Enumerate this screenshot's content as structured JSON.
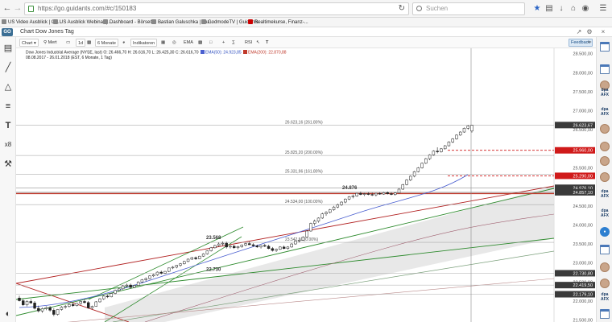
{
  "browser": {
    "url": "https://go.guidants.com/#c/150183",
    "search_placeholder": "Suchen",
    "bookmarks": [
      "US Video Ausblick | Gu...",
      "US Ausblick Webinar | ...",
      "Dashboard - BörseGo ...",
      "Bastian Galuschka | Gu...",
      "GodmodeTV | Guidants",
      "Realtimekurse, Finanz-..."
    ]
  },
  "app": {
    "logo": "GO",
    "chart_title": "Chart Dow Jones Tag"
  },
  "toolbar": {
    "chart_btn": "Chart",
    "mark_btn": "Mert",
    "interval": "1d",
    "period": "6 Monate",
    "indicators_btn": "Indikatoren",
    "ema_btn": "EMA",
    "rsi_btn": "RSI",
    "feedback": "Feedback"
  },
  "legend": {
    "line1": "Dow Jones Industrial Average (NYSE, last)  O: 26.466,70   H: 26.616,70   L: 26.425,30   C: 26.616,70",
    "ema50": "EMA(50): 24.923,85",
    "ema200": "EMA(200): 22.870,88",
    "line2": "08.08.2017 - 26.01.2018  (EST, 6 Monate, 1 Tag)"
  },
  "colors": {
    "ema50": "#4a5fd0",
    "ema200": "#c0392b",
    "channel_green": "#2e8b2e",
    "channel_red": "#b22222",
    "candle_up": "#ffffff",
    "candle_down": "#222222",
    "price_label_bg": "#3a3a3a",
    "price_label_red": "#d01a1a"
  },
  "chart_data": {
    "type": "candlestick",
    "instrument": "Dow Jones Industrial Average",
    "y_axis_ticks": [
      21500,
      22000,
      22500,
      23000,
      23500,
      24000,
      24500,
      25000,
      25500,
      26000,
      26500,
      27000,
      27500,
      28000,
      28500
    ],
    "y_tick_labels": [
      "21.500,00",
      "22.000,00",
      "22.500,00",
      "23.000,00",
      "23.500,00",
      "24.000,00",
      "24.500,00",
      "25.000,00",
      "25.500,00",
      "26.000,00",
      "26.500,00",
      "27.000,00",
      "27.500,00",
      "28.000,00",
      "28.500,00"
    ],
    "ylim": [
      21450,
      28640
    ],
    "price_labels": [
      {
        "value": 26623.67,
        "text": "26.623,67",
        "style": "dark"
      },
      {
        "value": 25960,
        "text": "25.960,00",
        "style": "red"
      },
      {
        "value": 25290,
        "text": "25.290,00",
        "style": "red"
      },
      {
        "value": 24976.1,
        "text": "24.976,10",
        "style": "dark"
      },
      {
        "value": 24857,
        "text": "24.857,10",
        "style": "dark"
      },
      {
        "value": 22730.8,
        "text": "22.730,80",
        "style": "dark"
      },
      {
        "value": 22419.5,
        "text": "22.419,50",
        "style": "dark"
      },
      {
        "value": 22179.1,
        "text": "22.179,10",
        "style": "dark"
      }
    ],
    "fib_levels": [
      {
        "value": 26623.16,
        "label": "26.623,16 (261.80%)"
      },
      {
        "value": 25825.2,
        "label": "25.825,20 (200.00%)"
      },
      {
        "value": 25331.96,
        "label": "25.331,96 (161.80%)"
      },
      {
        "value": 24534.0,
        "label": "24.534,00 (100.00%)"
      },
      {
        "value": 23542.5,
        "label": "23.542,50 (0.00%)"
      }
    ],
    "annotations": [
      {
        "text": "23.568",
        "value": 23568
      },
      {
        "text": "22.730",
        "value": 22730
      },
      {
        "text": "24.876",
        "value": 24876
      }
    ],
    "ohlc": [
      [
        22080,
        22140,
        21990,
        22010
      ],
      [
        22010,
        22060,
        21870,
        21900
      ],
      [
        21900,
        22020,
        21860,
        21990
      ],
      [
        21990,
        22050,
        21930,
        21950
      ],
      [
        21950,
        22000,
        21780,
        21810
      ],
      [
        21810,
        21880,
        21700,
        21740
      ],
      [
        21740,
        21830,
        21690,
        21800
      ],
      [
        21800,
        21860,
        21760,
        21830
      ],
      [
        21830,
        21870,
        21720,
        21760
      ],
      [
        21760,
        21810,
        21600,
        21650
      ],
      [
        21650,
        21790,
        21620,
        21780
      ],
      [
        21780,
        21870,
        21750,
        21840
      ],
      [
        21840,
        21900,
        21800,
        21860
      ],
      [
        21860,
        21940,
        21830,
        21910
      ],
      [
        21910,
        21960,
        21850,
        21880
      ],
      [
        21880,
        21950,
        21860,
        21940
      ],
      [
        21940,
        22010,
        21900,
        21990
      ],
      [
        21990,
        22050,
        21940,
        21960
      ],
      [
        21960,
        22000,
        21800,
        21820
      ],
      [
        21820,
        21880,
        21780,
        21860
      ],
      [
        21860,
        22000,
        21850,
        21980
      ],
      [
        21980,
        22080,
        21960,
        22060
      ],
      [
        22060,
        22150,
        22030,
        22130
      ],
      [
        22130,
        22170,
        22080,
        22110
      ],
      [
        22110,
        22210,
        22100,
        22200
      ],
      [
        22200,
        22300,
        22180,
        22280
      ],
      [
        22280,
        22340,
        22240,
        22320
      ],
      [
        22320,
        22420,
        22300,
        22400
      ],
      [
        22400,
        22460,
        22360,
        22420
      ],
      [
        22420,
        22460,
        22330,
        22360
      ],
      [
        22360,
        22430,
        22340,
        22410
      ],
      [
        22410,
        22520,
        22400,
        22500
      ],
      [
        22500,
        22580,
        22480,
        22560
      ],
      [
        22560,
        22620,
        22520,
        22590
      ],
      [
        22590,
        22680,
        22570,
        22660
      ],
      [
        22660,
        22720,
        22630,
        22690
      ],
      [
        22690,
        22780,
        22660,
        22760
      ],
      [
        22760,
        22800,
        22700,
        22730
      ],
      [
        22730,
        22790,
        22710,
        22780
      ],
      [
        22780,
        22880,
        22760,
        22870
      ],
      [
        22870,
        22920,
        22840,
        22890
      ],
      [
        22890,
        22950,
        22860,
        22940
      ],
      [
        22940,
        23000,
        22900,
        22980
      ],
      [
        22980,
        23060,
        22960,
        23040
      ],
      [
        23040,
        23120,
        23020,
        23100
      ],
      [
        23100,
        23160,
        23080,
        23140
      ],
      [
        23140,
        23170,
        23080,
        23110
      ],
      [
        23110,
        23190,
        23100,
        23180
      ],
      [
        23180,
        23260,
        23160,
        23240
      ],
      [
        23240,
        23330,
        23220,
        23320
      ],
      [
        23320,
        23420,
        23300,
        23400
      ],
      [
        23400,
        23480,
        23380,
        23460
      ],
      [
        23460,
        23540,
        23430,
        23500
      ],
      [
        23500,
        23568,
        23460,
        23520
      ],
      [
        23520,
        23560,
        23380,
        23420
      ],
      [
        23420,
        23470,
        23380,
        23440
      ],
      [
        23440,
        23480,
        23370,
        23400
      ],
      [
        23400,
        23450,
        23360,
        23430
      ],
      [
        23430,
        23490,
        23400,
        23470
      ],
      [
        23470,
        23530,
        23440,
        23510
      ],
      [
        23510,
        23560,
        23470,
        23480
      ],
      [
        23480,
        23520,
        23430,
        23450
      ],
      [
        23450,
        23480,
        23400,
        23420
      ],
      [
        23420,
        23470,
        23380,
        23460
      ],
      [
        23460,
        23500,
        23420,
        23440
      ],
      [
        23440,
        23480,
        23360,
        23380
      ],
      [
        23380,
        23420,
        23300,
        23330
      ],
      [
        23330,
        23380,
        23290,
        23360
      ],
      [
        23360,
        23440,
        23340,
        23420
      ],
      [
        23420,
        23460,
        23360,
        23380
      ],
      [
        23380,
        23440,
        23350,
        23420
      ],
      [
        23420,
        23520,
        23400,
        23500
      ],
      [
        23500,
        23600,
        23480,
        23580
      ],
      [
        23580,
        23620,
        23540,
        23600
      ],
      [
        23600,
        23700,
        23580,
        23680
      ],
      [
        23680,
        23860,
        23660,
        23840
      ],
      [
        23840,
        24060,
        23820,
        24040
      ],
      [
        24040,
        24140,
        23980,
        24100
      ],
      [
        24100,
        24200,
        24060,
        24180
      ],
      [
        24180,
        24320,
        24160,
        24290
      ],
      [
        24290,
        24360,
        24240,
        24330
      ],
      [
        24330,
        24420,
        24300,
        24400
      ],
      [
        24400,
        24500,
        24370,
        24470
      ],
      [
        24470,
        24560,
        24440,
        24530
      ],
      [
        24530,
        24620,
        24500,
        24600
      ],
      [
        24600,
        24700,
        24570,
        24680
      ],
      [
        24680,
        24760,
        24650,
        24740
      ],
      [
        24740,
        24800,
        24700,
        24760
      ],
      [
        24760,
        24840,
        24740,
        24830
      ],
      [
        24830,
        24876,
        24780,
        24800
      ],
      [
        24800,
        24840,
        24760,
        24820
      ],
      [
        24820,
        24860,
        24780,
        24800
      ],
      [
        24800,
        24850,
        24760,
        24790
      ],
      [
        24790,
        24840,
        24750,
        24830
      ],
      [
        24830,
        24860,
        24790,
        24810
      ],
      [
        24810,
        24870,
        24790,
        24850
      ],
      [
        24850,
        24880,
        24800,
        24820
      ],
      [
        24820,
        24860,
        24780,
        24800
      ],
      [
        24800,
        24850,
        24770,
        24840
      ],
      [
        24840,
        24960,
        24820,
        24940
      ],
      [
        24940,
        25080,
        24920,
        25060
      ],
      [
        25060,
        25200,
        25040,
        25180
      ],
      [
        25180,
        25300,
        25150,
        25280
      ],
      [
        25280,
        25420,
        25250,
        25400
      ],
      [
        25400,
        25520,
        25380,
        25500
      ],
      [
        25500,
        25640,
        25480,
        25620
      ],
      [
        25620,
        25760,
        25600,
        25740
      ],
      [
        25740,
        25860,
        25700,
        25840
      ],
      [
        25840,
        25960,
        25820,
        25940
      ],
      [
        25940,
        26040,
        25880,
        25920
      ],
      [
        25920,
        26020,
        25900,
        26000
      ],
      [
        26000,
        26100,
        25980,
        26080
      ],
      [
        26080,
        26200,
        26060,
        26180
      ],
      [
        26180,
        26280,
        26150,
        26260
      ],
      [
        26260,
        26380,
        26240,
        26360
      ],
      [
        26360,
        26460,
        26340,
        26440
      ],
      [
        26440,
        26560,
        26420,
        26540
      ],
      [
        26540,
        26620,
        26500,
        26600
      ],
      [
        26466,
        26616,
        26425,
        26616
      ]
    ]
  }
}
